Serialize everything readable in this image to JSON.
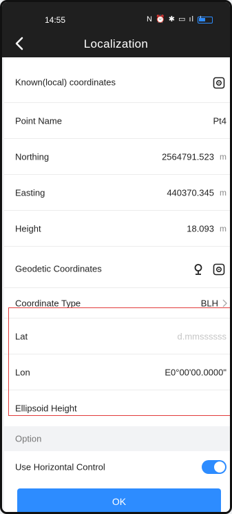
{
  "status_bar": {
    "time": "14:55",
    "icons_text": "N ⏰ ✱ ▭ ıl ıl"
  },
  "title_bar": {
    "title": "Localization"
  },
  "known_section": {
    "title": "Known(local) coordinates",
    "icon": "locate-device-icon"
  },
  "known_fields": [
    {
      "label": "Point Name",
      "value": "Pt4",
      "unit": ""
    },
    {
      "label": "Northing",
      "value": "2564791.523",
      "unit": "m"
    },
    {
      "label": "Easting",
      "value": "440370.345",
      "unit": "m"
    },
    {
      "label": "Height",
      "value": "18.093",
      "unit": "m"
    }
  ],
  "geodetic_section": {
    "title": "Geodetic Coordinates",
    "icons": [
      "map-pin-icon",
      "locate-device-icon"
    ]
  },
  "coordinate_type": {
    "label": "Coordinate Type",
    "value": "BLH"
  },
  "geodetic_fields": [
    {
      "label": "Lat",
      "value": "",
      "placeholder": "d.mmssssss"
    },
    {
      "label": "Lon",
      "value": "E0°00'00.0000\"",
      "placeholder": ""
    },
    {
      "label": "Ellipsoid Height",
      "value": "",
      "placeholder": ""
    }
  ],
  "option_section": {
    "title": "Option"
  },
  "horizontal_control": {
    "label": "Use Horizontal Control",
    "enabled": true
  },
  "ok_button": {
    "label": "OK"
  },
  "colors": {
    "accent": "#2d8cff",
    "highlight_border": "#e23b3b",
    "header_bg": "#1f1f1f"
  }
}
